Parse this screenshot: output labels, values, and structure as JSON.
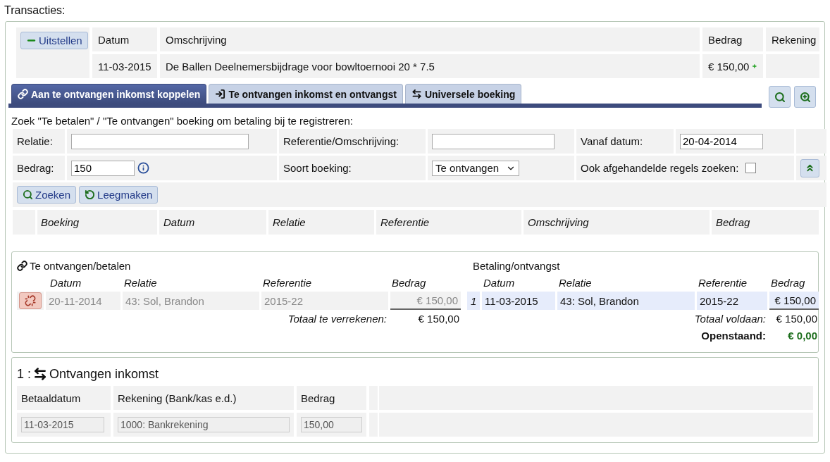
{
  "title": "Transacties:",
  "transaction": {
    "postpone_button": "Uitstellen",
    "columns": [
      "Datum",
      "Omschrijving",
      "Bedrag",
      "Rekening"
    ],
    "date": "11-03-2015",
    "description": "De Ballen Deelnemersbijdrage voor bowltoernooi 20 * 7.5",
    "amount": "€ 150,00"
  },
  "tabs": [
    {
      "label": "Aan te ontvangen inkomst koppelen",
      "kind": "link",
      "selected": true
    },
    {
      "label": "Te ontvangen inkomst en ontvangst",
      "kind": "sign-in",
      "selected": false
    },
    {
      "label": "Universele boeking",
      "kind": "exchange",
      "selected": false
    }
  ],
  "search": {
    "heading": "Zoek \"Te betalen\" / \"Te ontvangen\" boeking om betaling bij te registreren:",
    "relation": {
      "label": "Relatie:"
    },
    "reference": {
      "label": "Referentie/Omschrijving:"
    },
    "from_date": {
      "label": "Vanaf datum:",
      "value": "20-04-2014"
    },
    "amount": {
      "label": "Bedrag:",
      "value": "150"
    },
    "booking_type": {
      "label": "Soort boeking:",
      "value": "Te ontvangen"
    },
    "include_done": {
      "label": "Ook afgehandelde regels zoeken:",
      "checked": false
    },
    "buttons": [
      {
        "label": "Zoeken",
        "kind": "search"
      },
      {
        "label": "Leegmaken",
        "kind": "reset"
      }
    ],
    "result_columns": [
      "Boeking",
      "Datum",
      "Relatie",
      "Referentie",
      "Omschrijving",
      "Bedrag"
    ]
  },
  "matching": {
    "left": {
      "title": "Te ontvangen/betalen",
      "columns": [
        "Datum",
        "Relatie",
        "Referentie",
        "Bedrag"
      ],
      "rows": [
        {
          "date": "20-11-2014",
          "relation": "43: Sol, Brandon",
          "reference": "2015-22",
          "amount": "€ 150,00"
        }
      ],
      "total_label": "Totaal te verrekenen:",
      "total": "€ 150,00"
    },
    "right": {
      "title": "Betaling/ontvangst",
      "columns": [
        "Datum",
        "Relatie",
        "Referentie",
        "Bedrag"
      ],
      "rows": [
        {
          "index": "1",
          "date": "11-03-2015",
          "relation": "43: Sol, Brandon",
          "reference": "2015-22",
          "amount": "€ 150,00"
        }
      ],
      "total_label": "Totaal voldaan:",
      "total": "€ 150,00",
      "open_label": "Openstaand:",
      "open": "€ 0,00"
    }
  },
  "booking": {
    "number": "1 :",
    "title": "Ontvangen inkomst",
    "columns": [
      "Betaaldatum",
      "Rekening (Bank/kas e.d.)",
      "Bedrag"
    ],
    "values": [
      "11-03-2015",
      "1000: Bankrekening",
      "150,00"
    ]
  }
}
